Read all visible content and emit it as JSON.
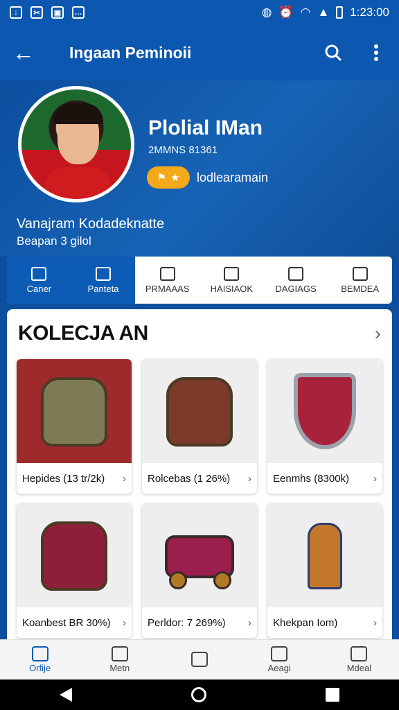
{
  "status_bar": {
    "time": "1:23:00"
  },
  "app_bar": {
    "title": "Ingaan Peminoii",
    "back_icon": "arrow-left-icon",
    "search_icon": "search-icon",
    "menu_icon": "more-vert-icon"
  },
  "profile": {
    "name": "Plolial IMan",
    "id": "2MMNS 81361",
    "badge_label": "lodlearamain",
    "sub_name": "Vanajram Kodadeknatte",
    "sub_info": "Beapan 3 gilol"
  },
  "tabs": [
    {
      "label": "Caner",
      "icon": "home-icon"
    },
    {
      "label": "Panteta",
      "icon": "shirt-icon"
    },
    {
      "label": "PRMAAAS",
      "icon": "house-icon"
    },
    {
      "label": "HAISIAOK",
      "icon": "box-icon"
    },
    {
      "label": "DAGIAGS",
      "icon": "tag-icon"
    },
    {
      "label": "BEMDEA",
      "icon": "door-icon"
    }
  ],
  "collection": {
    "title": "KOLECJA AN",
    "items": [
      {
        "label": "Hepides (13 tr/2k)"
      },
      {
        "label": "Rolcebas (1 26%)"
      },
      {
        "label": "Eenmhs (8300k)"
      },
      {
        "label": "Koanbest BR 30%)"
      },
      {
        "label": "Perldor: 7 269%)"
      },
      {
        "label": "Khekpan Iom)"
      }
    ]
  },
  "bottom_nav": [
    {
      "label": "Orfije",
      "icon": "home-icon"
    },
    {
      "label": "Metn",
      "icon": "person-icon"
    },
    {
      "label": "",
      "icon": "box-icon"
    },
    {
      "label": "Aeagi",
      "icon": "shield-icon"
    },
    {
      "label": "Mdeal",
      "icon": "person-icon"
    }
  ],
  "colors": {
    "primary": "#0c57b0",
    "accent": "#f4a91a"
  }
}
